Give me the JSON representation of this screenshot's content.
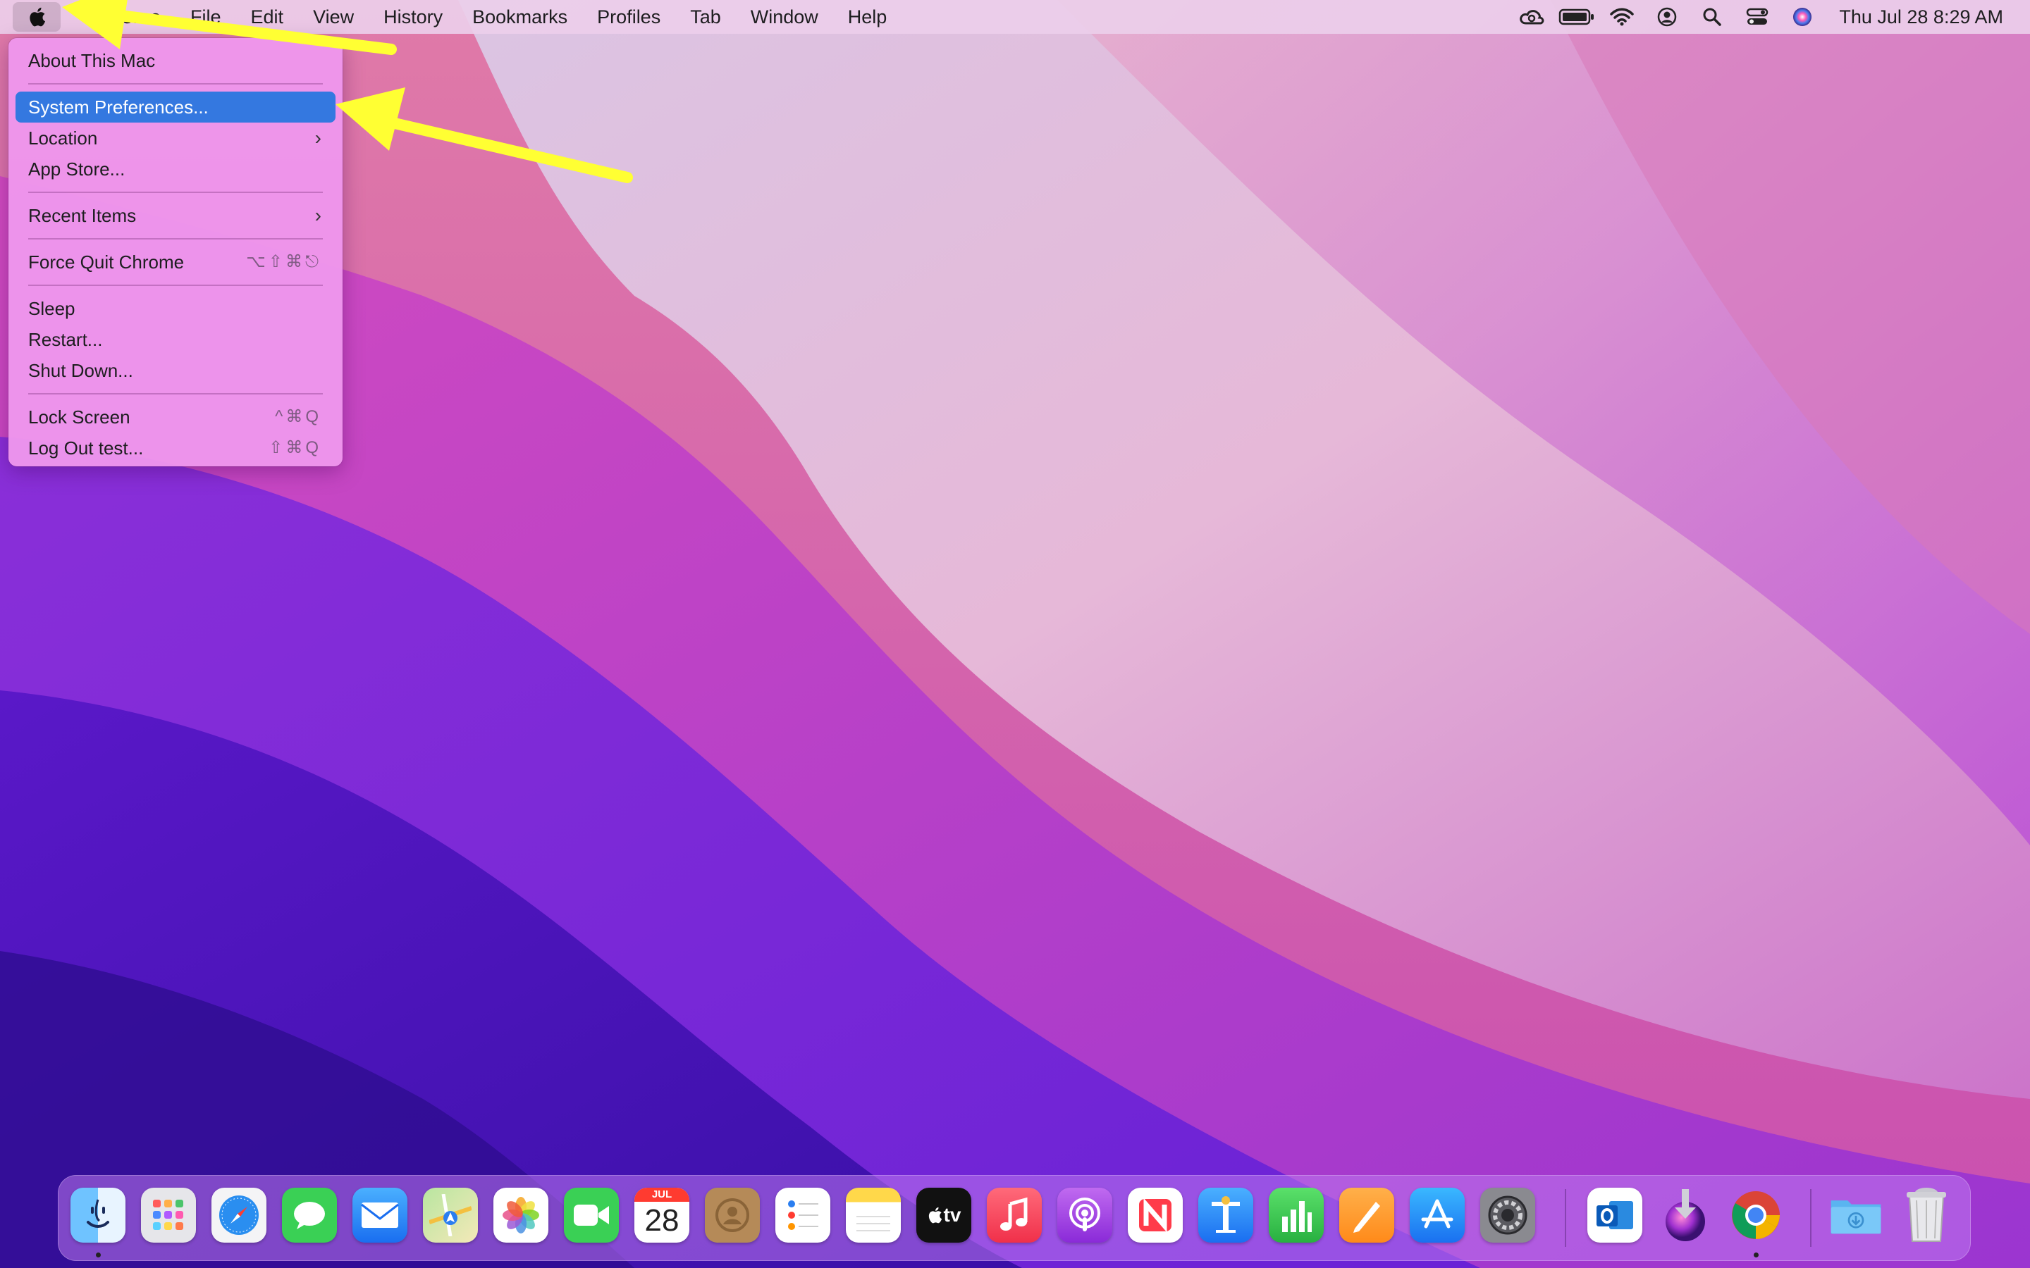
{
  "menubar": {
    "app_name": "Chrome",
    "menus": [
      "File",
      "Edit",
      "View",
      "History",
      "Bookmarks",
      "Profiles",
      "Tab",
      "Window",
      "Help"
    ],
    "status_icons": [
      "creative-cloud-icon",
      "battery-icon",
      "wifi-icon",
      "user-account-icon",
      "spotlight-search-icon",
      "control-center-icon",
      "siri-icon"
    ],
    "clock": "Thu Jul 28  8:29 AM"
  },
  "apple_menu": {
    "about": "About This Mac",
    "system_preferences": "System Preferences...",
    "location": "Location",
    "app_store": "App Store...",
    "recent_items": "Recent Items",
    "force_quit": "Force Quit Chrome",
    "force_quit_shortcut": "⌥⇧⌘⎋",
    "sleep": "Sleep",
    "restart": "Restart...",
    "shut_down": "Shut Down...",
    "lock_screen": "Lock Screen",
    "lock_screen_shortcut": "^⌘Q",
    "log_out": "Log Out test...",
    "log_out_shortcut": "⇧⌘Q"
  },
  "dock": {
    "calendar_month": "JUL",
    "calendar_day": "28",
    "tv_label": "tv",
    "apps": [
      "Finder",
      "Launchpad",
      "Safari",
      "Messages",
      "Mail",
      "Maps",
      "Photos",
      "FaceTime",
      "Calendar",
      "Contacts",
      "Reminders",
      "Notes",
      "TV",
      "Music",
      "Podcasts",
      "News",
      "Keynote",
      "Numbers",
      "Pages",
      "App Store",
      "System Preferences",
      "Outlook",
      "Installer",
      "Chrome",
      "Downloads",
      "Trash"
    ]
  },
  "colors": {
    "highlight": "#3478e0",
    "annotation_arrow": "#ffff33"
  }
}
